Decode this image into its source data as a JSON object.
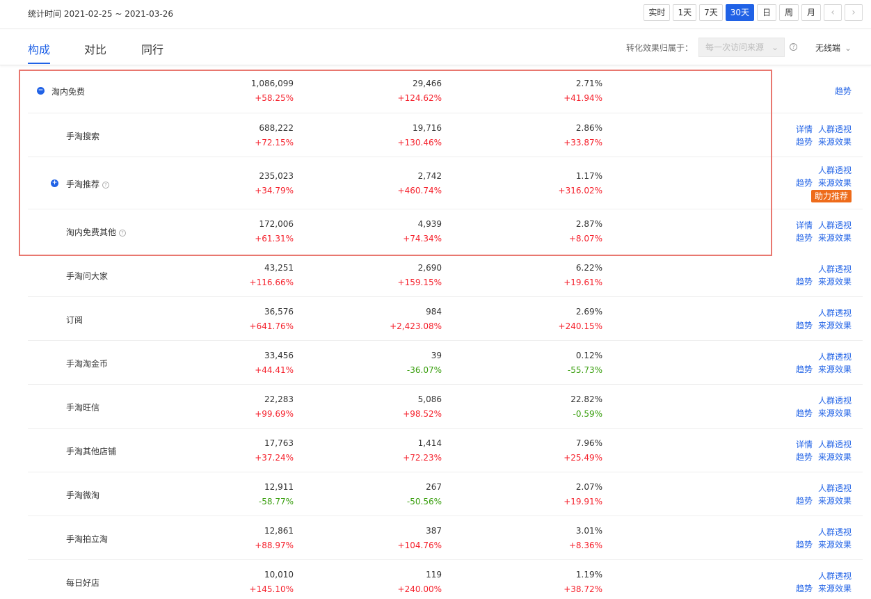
{
  "header": {
    "stat_time": "统计时间 2021-02-25 ~ 2021-03-26",
    "date_buttons": [
      "实时",
      "1天",
      "7天",
      "30天",
      "日",
      "周",
      "月"
    ],
    "active_index": 3,
    "prev_icon": "‹",
    "next_icon": "›"
  },
  "tabs": [
    "构成",
    "对比",
    "同行"
  ],
  "attribution": {
    "label": "转化效果归属于：",
    "value": "每一次访问来源",
    "help": "?"
  },
  "device": {
    "value": "无线端"
  },
  "colors": {
    "accent": "#2062e6",
    "up": "#f5222d",
    "down": "#389e0d",
    "neutral": "#666666",
    "badge": "#ee6b1a",
    "highlight": "#e8776f"
  },
  "rows": [
    {
      "name": "淘内免费",
      "toggle": "−",
      "has_help": false,
      "v1": "1,086,099",
      "c1": "+58.25%",
      "v2": "29,466",
      "c2": "+124.62%",
      "v3": "2.71%",
      "c3": "+41.94%",
      "links": [
        "趋势"
      ]
    },
    {
      "name": "手淘搜索",
      "toggle": "",
      "has_help": false,
      "v1": "688,222",
      "c1": "+72.15%",
      "v2": "19,716",
      "c2": "+130.46%",
      "v3": "2.86%",
      "c3": "+33.87%",
      "links": [
        "详情",
        "人群透视",
        "趋势",
        "来源效果"
      ]
    },
    {
      "name": "手淘推荐",
      "toggle": "+",
      "has_help": true,
      "v1": "235,023",
      "c1": "+34.79%",
      "v2": "2,742",
      "c2": "+460.74%",
      "v3": "1.17%",
      "c3": "+316.02%",
      "links": [
        "人群透视",
        "趋势",
        "来源效果"
      ],
      "badge": "助力推荐"
    },
    {
      "name": "淘内免费其他",
      "toggle": "",
      "has_help": true,
      "v1": "172,006",
      "c1": "+61.31%",
      "v2": "4,939",
      "c2": "+74.34%",
      "v3": "2.87%",
      "c3": "+8.07%",
      "links": [
        "详情",
        "人群透视",
        "趋势",
        "来源效果"
      ]
    },
    {
      "name": "手淘问大家",
      "toggle": "",
      "has_help": false,
      "v1": "43,251",
      "c1": "+116.66%",
      "v2": "2,690",
      "c2": "+159.15%",
      "v3": "6.22%",
      "c3": "+19.61%",
      "links": [
        "人群透视",
        "趋势",
        "来源效果"
      ]
    },
    {
      "name": "订阅",
      "toggle": "",
      "has_help": false,
      "v1": "36,576",
      "c1": "+641.76%",
      "v2": "984",
      "c2": "+2,423.08%",
      "v3": "2.69%",
      "c3": "+240.15%",
      "links": [
        "人群透视",
        "趋势",
        "来源效果"
      ]
    },
    {
      "name": "手淘淘金币",
      "toggle": "",
      "has_help": false,
      "v1": "33,456",
      "c1": "+44.41%",
      "v2": "39",
      "c2": "-36.07%",
      "v3": "0.12%",
      "c3": "-55.73%",
      "links": [
        "人群透视",
        "趋势",
        "来源效果"
      ]
    },
    {
      "name": "手淘旺信",
      "toggle": "",
      "has_help": false,
      "v1": "22,283",
      "c1": "+99.69%",
      "v2": "5,086",
      "c2": "+98.52%",
      "v3": "22.82%",
      "c3": "-0.59%",
      "links": [
        "人群透视",
        "趋势",
        "来源效果"
      ]
    },
    {
      "name": "手淘其他店铺",
      "toggle": "",
      "has_help": false,
      "v1": "17,763",
      "c1": "+37.24%",
      "v2": "1,414",
      "c2": "+72.23%",
      "v3": "7.96%",
      "c3": "+25.49%",
      "links": [
        "详情",
        "人群透视",
        "趋势",
        "来源效果"
      ]
    },
    {
      "name": "手淘微淘",
      "toggle": "",
      "has_help": false,
      "v1": "12,911",
      "c1": "-58.77%",
      "v2": "267",
      "c2": "-50.56%",
      "v3": "2.07%",
      "c3": "+19.91%",
      "links": [
        "人群透视",
        "趋势",
        "来源效果"
      ]
    },
    {
      "name": "手淘拍立淘",
      "toggle": "",
      "has_help": false,
      "v1": "12,861",
      "c1": "+88.97%",
      "v2": "387",
      "c2": "+104.76%",
      "v3": "3.01%",
      "c3": "+8.36%",
      "links": [
        "人群透视",
        "趋势",
        "来源效果"
      ]
    },
    {
      "name": "每日好店",
      "toggle": "",
      "has_help": false,
      "v1": "10,010",
      "c1": "+145.10%",
      "v2": "119",
      "c2": "+240.00%",
      "v3": "1.19%",
      "c3": "+38.72%",
      "links": [
        "人群透视",
        "趋势",
        "来源效果"
      ]
    }
  ]
}
